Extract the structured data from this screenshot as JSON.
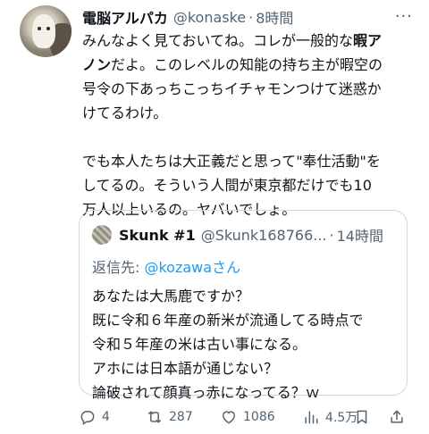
{
  "tweet": {
    "display_name": "電脳アルパカ",
    "handle": "@konaske",
    "separator": "·",
    "time": "8時間",
    "more": "···",
    "body_lines": [
      [
        "みんなよく見ておいてね。コレが一般的な",
        "暇ア"
      ],
      [
        "ノン",
        "だよ。このレベルの知能の持ち主が暇空の"
      ],
      [
        "号令の下あっちこっちイチャモンつけて迷惑か"
      ],
      [
        "けてるわけ。"
      ],
      [
        "でも本人たちは大正義だと思って\"奉仕活動\"を"
      ],
      [
        "してるの。そういう人間が東京都だけでも10"
      ],
      [
        "万人以上いるの。ヤバいでしょ。"
      ]
    ]
  },
  "quote": {
    "display_name": "Skunk #1",
    "handle": "@Skunk168766...",
    "separator": "·",
    "time": "14時間",
    "reply_prefix": "返信先: ",
    "reply_mention": "@kozawa",
    "reply_suffix": "さん",
    "lines": [
      "あなたは大馬鹿ですか？",
      "既に令和６年産の新米が流通してる時点で",
      "令和５年産の米は古い事になる。",
      "アホには日本語が通じない？",
      "論破されて顔真っ赤になってる？ｗ"
    ]
  },
  "actions": {
    "replies": "4",
    "reposts": "287",
    "likes": "1086",
    "views": "4.5万"
  },
  "icons": {
    "reply": "reply-icon",
    "repost": "repost-icon",
    "like": "heart-icon",
    "views": "views-icon",
    "bookmark": "bookmark-icon",
    "share": "share-icon"
  },
  "colors": {
    "text": "#0f1419",
    "secondary": "#536471",
    "link": "#1d9bf0",
    "border": "#cfd9de"
  }
}
